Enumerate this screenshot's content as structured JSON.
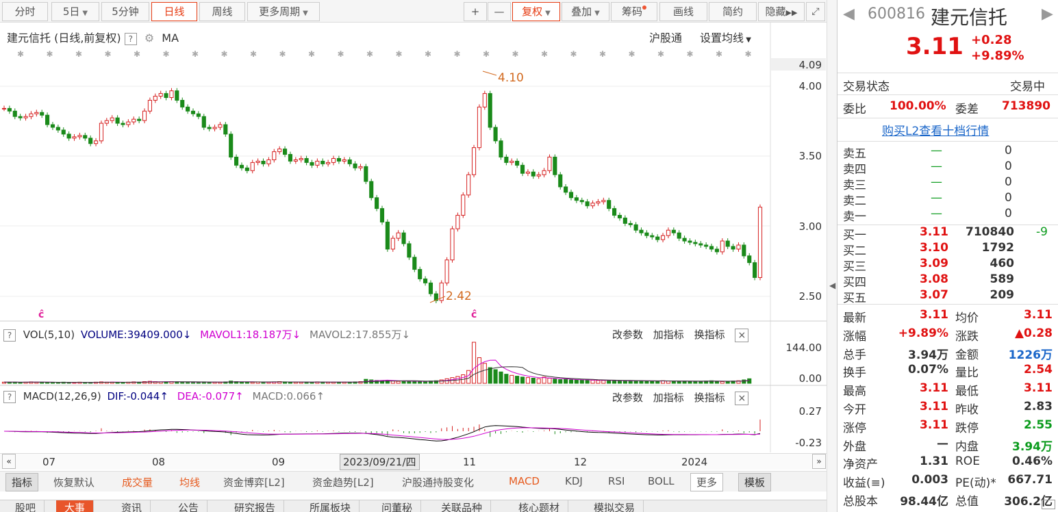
{
  "toolbar": {
    "periods": [
      "分时",
      "5日",
      "5分钟",
      "日线",
      "周线",
      "更多周期"
    ],
    "active": "日线",
    "zoom_in": "+",
    "zoom_out": "—",
    "fuquan": "复权",
    "overlay": "叠加",
    "chips": "筹码",
    "draw": "画线",
    "simple": "简约",
    "hide": "隐藏"
  },
  "chart": {
    "title": "建元信托 (日线,前复权)",
    "ma_label": "MA",
    "hgt": "沪股通",
    "ma_settings": "设置均线",
    "high_mark": "4.10",
    "low_mark": "2.42",
    "y_top_label": "4.09",
    "y_ticks": [
      "4.00",
      "3.50",
      "3.00",
      "2.50"
    ],
    "q": "?"
  },
  "vol": {
    "header": "VOL(5,10)",
    "volume": "VOLUME:39409.000",
    "mavol1": "MAVOL1:18.187万",
    "mavol2": "MAVOL2:17.855万",
    "y_ticks": [
      "144.00",
      "0.00"
    ]
  },
  "macd": {
    "header": "MACD(12,26,9)",
    "dif": "DIF:-0.044",
    "dea": "DEA:-0.077",
    "macd": "MACD:0.066",
    "y_ticks": [
      "0.27",
      "-0.23"
    ]
  },
  "panel_buttons": {
    "params": "改参数",
    "add": "加指标",
    "switch": "换指标",
    "close": "×"
  },
  "xaxis": {
    "labels": [
      "07",
      "08",
      "09",
      "11",
      "12",
      "2024"
    ],
    "current": "2023/09/21/四"
  },
  "indicators": [
    "指标",
    "恢复默认",
    "成交量",
    "均线",
    "资金博弈[L2]",
    "资金趋势[L2]",
    "沪股通持股变化",
    "MACD",
    "KDJ",
    "RSI",
    "BOLL",
    "更多",
    "模板"
  ],
  "bottom_tabs": [
    "股吧",
    "大事",
    "资讯",
    "公告",
    "研究报告",
    "所属板块",
    "问董秘",
    "关联品种",
    "核心题材",
    "模拟交易"
  ],
  "quote": {
    "code": "600816",
    "name": "建元信托",
    "price": "3.11",
    "change": "+0.28",
    "pct": "+9.89%",
    "status_label": "交易状态",
    "status": "交易中",
    "wb_label": "委比",
    "wb": "100.00%",
    "wc_label": "委差",
    "wc": "713890",
    "l2_link": "购买L2查看十档行情",
    "asks": [
      {
        "label": "卖五",
        "price": "—",
        "vol": "0"
      },
      {
        "label": "卖四",
        "price": "—",
        "vol": "0"
      },
      {
        "label": "卖三",
        "price": "—",
        "vol": "0"
      },
      {
        "label": "卖二",
        "price": "—",
        "vol": "0"
      },
      {
        "label": "卖一",
        "price": "—",
        "vol": "0"
      }
    ],
    "bids": [
      {
        "label": "买一",
        "price": "3.11",
        "vol": "710840",
        "chg": "-9"
      },
      {
        "label": "买二",
        "price": "3.10",
        "vol": "1792",
        "chg": ""
      },
      {
        "label": "买三",
        "price": "3.09",
        "vol": "460",
        "chg": ""
      },
      {
        "label": "买四",
        "price": "3.08",
        "vol": "589",
        "chg": ""
      },
      {
        "label": "买五",
        "price": "3.07",
        "vol": "209",
        "chg": ""
      }
    ],
    "stats": [
      [
        "最新",
        "3.11",
        "均价",
        "3.11"
      ],
      [
        "涨幅",
        "+9.89%",
        "涨跌",
        "▲0.28"
      ],
      [
        "总手",
        "3.94万",
        "金额",
        "1226万"
      ],
      [
        "换手",
        "0.07%",
        "量比",
        "2.54"
      ],
      [
        "最高",
        "3.11",
        "最低",
        "3.11"
      ],
      [
        "今开",
        "3.11",
        "昨收",
        "2.83"
      ],
      [
        "涨停",
        "3.11",
        "跌停",
        "2.55"
      ],
      [
        "外盘",
        "—",
        "内盘",
        "3.94万"
      ],
      [
        "净资产",
        "1.31",
        "ROE",
        "0.46%"
      ],
      [
        "收益(≡)",
        "0.003",
        "PE(动)*",
        "667.71"
      ],
      [
        "总股本",
        "98.44亿",
        "总值",
        "306.2亿"
      ]
    ]
  },
  "chart_data": {
    "type": "candlestick",
    "y_range": [
      2.4,
      4.12
    ],
    "closes": [
      3.84,
      3.82,
      3.78,
      3.77,
      3.78,
      3.8,
      3.81,
      3.79,
      3.72,
      3.7,
      3.68,
      3.65,
      3.62,
      3.63,
      3.64,
      3.62,
      3.58,
      3.6,
      3.73,
      3.75,
      3.77,
      3.73,
      3.72,
      3.74,
      3.76,
      3.75,
      3.82,
      3.9,
      3.93,
      3.95,
      3.92,
      3.97,
      3.9,
      3.85,
      3.82,
      3.8,
      3.78,
      3.7,
      3.69,
      3.7,
      3.72,
      3.65,
      3.48,
      3.42,
      3.4,
      3.38,
      3.44,
      3.45,
      3.43,
      3.46,
      3.52,
      3.54,
      3.5,
      3.45,
      3.46,
      3.47,
      3.44,
      3.42,
      3.45,
      3.43,
      3.44,
      3.47,
      3.45,
      3.46,
      3.43,
      3.4,
      3.41,
      3.3,
      3.18,
      3.1,
      3.0,
      2.8,
      2.88,
      2.92,
      2.84,
      2.74,
      2.65,
      2.58,
      2.55,
      2.47,
      2.42,
      2.55,
      2.72,
      2.95,
      3.05,
      3.2,
      3.35,
      3.55,
      3.85,
      3.95,
      3.7,
      3.6,
      3.48,
      3.44,
      3.45,
      3.42,
      3.36,
      3.37,
      3.34,
      3.35,
      3.38,
      3.48,
      3.35,
      3.26,
      3.22,
      3.18,
      3.16,
      3.15,
      3.12,
      3.14,
      3.15,
      3.16,
      3.1,
      3.05,
      3.03,
      2.99,
      2.98,
      2.94,
      2.92,
      2.9,
      2.89,
      2.87,
      2.9,
      2.94,
      2.92,
      2.88,
      2.86,
      2.85,
      2.84,
      2.83,
      2.82,
      2.8,
      2.78,
      2.86,
      2.82,
      2.8,
      2.83,
      2.75,
      2.7,
      2.59,
      3.11
    ],
    "volumes": [
      4,
      4,
      4,
      3,
      4,
      5,
      4,
      4,
      3,
      3,
      3,
      4,
      3,
      3,
      4,
      3,
      3,
      4,
      5,
      4,
      4,
      3,
      3,
      4,
      5,
      4,
      6,
      7,
      6,
      5,
      5,
      6,
      5,
      4,
      4,
      4,
      4,
      5,
      4,
      4,
      4,
      5,
      8,
      6,
      5,
      4,
      4,
      5,
      4,
      4,
      5,
      6,
      5,
      4,
      4,
      4,
      4,
      4,
      5,
      4,
      4,
      4,
      4,
      4,
      4,
      5,
      6,
      14,
      12,
      10,
      9,
      10,
      8,
      7,
      7,
      8,
      7,
      7,
      6,
      8,
      9,
      12,
      16,
      20,
      24,
      30,
      45,
      144,
      90,
      70,
      55,
      48,
      40,
      32,
      28,
      25,
      22,
      20,
      18,
      16,
      22,
      18,
      15,
      13,
      14,
      12,
      12,
      11,
      12,
      11,
      10,
      10,
      10,
      9,
      9,
      9,
      9,
      8,
      9,
      8,
      8,
      8,
      9,
      8,
      8,
      7,
      8,
      7,
      7,
      7,
      8,
      9,
      7,
      6,
      7,
      8,
      9,
      12,
      16
    ]
  }
}
